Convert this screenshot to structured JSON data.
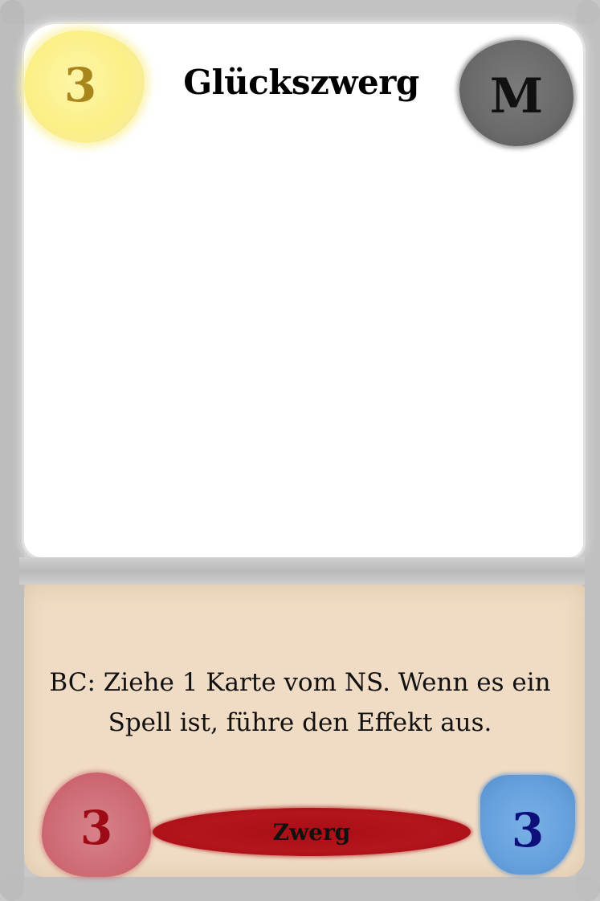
{
  "card": {
    "name": "Glückszwerg",
    "mana_cost": "3",
    "rarity": "M",
    "effect_text": "BC: Ziehe 1 Karte vom NS. Wenn es ein Spell ist, führe den Effekt aus.",
    "tribe": "Zwerg",
    "attack": "3",
    "health": "3"
  },
  "colors": {
    "frame": "#c8c8c8",
    "text_box": "#f0dcc4",
    "cost_gem": "#fbef86",
    "cost_text": "#a8861c",
    "rarity_gem": "#6a6a6a",
    "attack_gem": "#cd6a74",
    "attack_text": "#9c0b16",
    "health_gem": "#66a1dd",
    "health_text": "#0d0f7a",
    "tribe_banner": "#b3161c"
  }
}
